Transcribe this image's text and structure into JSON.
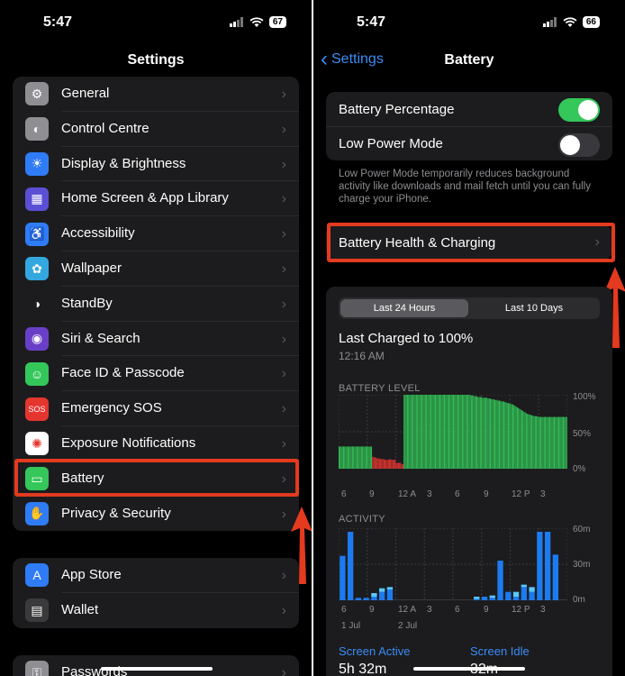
{
  "left": {
    "status": {
      "time": "5:47",
      "battery": "67"
    },
    "title": "Settings",
    "group1": [
      {
        "label": "General",
        "icon": "gear-icon",
        "color": "#8e8e93",
        "glyph": "⚙"
      },
      {
        "label": "Control Centre",
        "icon": "toggles-icon",
        "color": "#8e8e93",
        "glyph": "◐"
      },
      {
        "label": "Display & Brightness",
        "icon": "sun-icon",
        "color": "#2f7cf6",
        "glyph": "☀"
      },
      {
        "label": "Home Screen & App Library",
        "icon": "grid-icon",
        "color": "#5b4fd6",
        "glyph": "▦"
      },
      {
        "label": "Accessibility",
        "icon": "accessibility-icon",
        "color": "#2f7cf6",
        "glyph": "♿"
      },
      {
        "label": "Wallpaper",
        "icon": "flower-icon",
        "color": "#33a8e0",
        "glyph": "✿"
      },
      {
        "label": "StandBy",
        "icon": "standby-icon",
        "color": "#1c1c1e",
        "glyph": "◑"
      },
      {
        "label": "Siri & Search",
        "icon": "siri-icon",
        "color": "#6a3fc8",
        "glyph": "◉"
      },
      {
        "label": "Face ID & Passcode",
        "icon": "faceid-icon",
        "color": "#34c759",
        "glyph": "☺"
      },
      {
        "label": "Emergency SOS",
        "icon": "sos-icon",
        "color": "#e5352f",
        "glyph": "SOS"
      },
      {
        "label": "Exposure Notifications",
        "icon": "exposure-icon",
        "color": "#ffffff",
        "glyph": "✺"
      },
      {
        "label": "Battery",
        "icon": "battery-icon",
        "color": "#34c759",
        "glyph": "▭"
      },
      {
        "label": "Privacy & Security",
        "icon": "hand-icon",
        "color": "#2f7cf6",
        "glyph": "✋"
      }
    ],
    "group2": [
      {
        "label": "App Store",
        "icon": "appstore-icon",
        "color": "#2f7cf6",
        "glyph": "A"
      },
      {
        "label": "Wallet",
        "icon": "wallet-icon",
        "color": "#3a3a3c",
        "glyph": "▤"
      }
    ],
    "group3": [
      {
        "label": "Passwords",
        "icon": "key-icon",
        "color": "#8e8e93",
        "glyph": "⚿"
      }
    ]
  },
  "right": {
    "status": {
      "time": "5:47",
      "battery": "66"
    },
    "back_label": "Settings",
    "title": "Battery",
    "battery_percentage_label": "Battery Percentage",
    "battery_percentage_on": true,
    "low_power_label": "Low Power Mode",
    "low_power_on": false,
    "footnote": "Low Power Mode temporarily reduces background activity like downloads and mail fetch until you can fully charge your iPhone.",
    "health_label": "Battery Health & Charging",
    "segments": [
      "Last 24 Hours",
      "Last 10 Days"
    ],
    "selected_segment": "Last 24 Hours",
    "last_charged": "Last Charged to 100%",
    "last_charged_time": "12:16 AM",
    "screen_active_label": "Screen Active",
    "screen_active_value": "5h 32m",
    "screen_idle_label": "Screen Idle",
    "screen_idle_value": "32m"
  },
  "chart_data": [
    {
      "type": "bar",
      "title": "BATTERY LEVEL",
      "x_tick_labels": [
        "6",
        "9",
        "12 A",
        "3",
        "6",
        "9",
        "12 P",
        "3"
      ],
      "y_tick_labels": [
        "100%",
        "50%",
        "0%"
      ],
      "ylim": [
        0,
        100
      ],
      "low_battery_color": "#e5352f",
      "normal_color": "#34c759",
      "values": [
        30,
        30,
        30,
        30,
        30,
        30,
        30,
        30,
        30,
        30,
        30,
        30,
        30,
        30,
        30,
        30,
        30,
        30,
        30,
        30,
        30,
        30,
        30,
        30,
        30,
        30,
        30,
        30,
        30,
        30,
        16,
        16,
        15,
        15,
        14,
        14,
        14,
        13,
        13,
        13,
        13,
        12,
        12,
        12,
        12,
        13,
        13,
        12,
        12,
        12,
        12,
        8,
        8,
        8,
        8,
        8,
        6,
        6,
        100,
        100,
        100,
        100,
        100,
        100,
        100,
        100,
        100,
        100,
        100,
        100,
        100,
        100,
        100,
        100,
        100,
        100,
        100,
        100,
        100,
        100,
        100,
        100,
        100,
        100,
        100,
        100,
        100,
        100,
        100,
        100,
        100,
        100,
        100,
        100,
        100,
        100,
        100,
        100,
        100,
        100,
        100,
        100,
        100,
        100,
        100,
        100,
        100,
        100,
        100,
        100,
        100,
        100,
        100,
        100,
        100,
        100,
        100,
        100,
        99,
        99,
        99,
        98,
        98,
        98,
        97,
        97,
        97,
        97,
        96,
        96,
        96,
        96,
        96,
        95,
        95,
        95,
        94,
        94,
        94,
        93,
        93,
        93,
        92,
        92,
        92,
        91,
        91,
        91,
        90,
        90,
        89,
        89,
        88,
        88,
        87,
        87,
        86,
        85,
        84,
        83,
        82,
        81,
        80,
        79,
        78,
        77,
        76,
        75,
        74,
        74,
        73,
        73,
        72,
        72,
        71,
        71,
        71,
        71,
        70,
        70,
        70,
        70,
        70,
        70,
        70,
        70,
        70,
        70,
        70,
        70,
        70,
        70,
        70,
        70,
        70,
        70,
        70,
        70,
        70,
        70,
        70,
        70,
        70,
        70
      ]
    },
    {
      "type": "bar",
      "title": "ACTIVITY",
      "x_tick_labels": [
        "6",
        "9",
        "12 A",
        "3",
        "6",
        "9",
        "12 P",
        "3"
      ],
      "x_date_labels": [
        "1 Jul",
        "2 Jul"
      ],
      "y_tick_labels": [
        "60m",
        "30m",
        "0m"
      ],
      "ylim": [
        0,
        60
      ],
      "series": [
        {
          "name": "Screen Active",
          "color": "#1d7bf0",
          "values": [
            37,
            57,
            2,
            2,
            3,
            7,
            9,
            0,
            0,
            0,
            0,
            0,
            0,
            0,
            0,
            0,
            0,
            1,
            3,
            2,
            33,
            7,
            3,
            11,
            7,
            57,
            57,
            38,
            0
          ]
        },
        {
          "name": "Screen Idle",
          "color": "#5ac8fa",
          "values": [
            0,
            0,
            0,
            0,
            3,
            3,
            2,
            0,
            0,
            0,
            0,
            0,
            0,
            0,
            0,
            0,
            0,
            2,
            0,
            2,
            0,
            0,
            4,
            2,
            4,
            0,
            0,
            0,
            0
          ]
        }
      ]
    }
  ]
}
